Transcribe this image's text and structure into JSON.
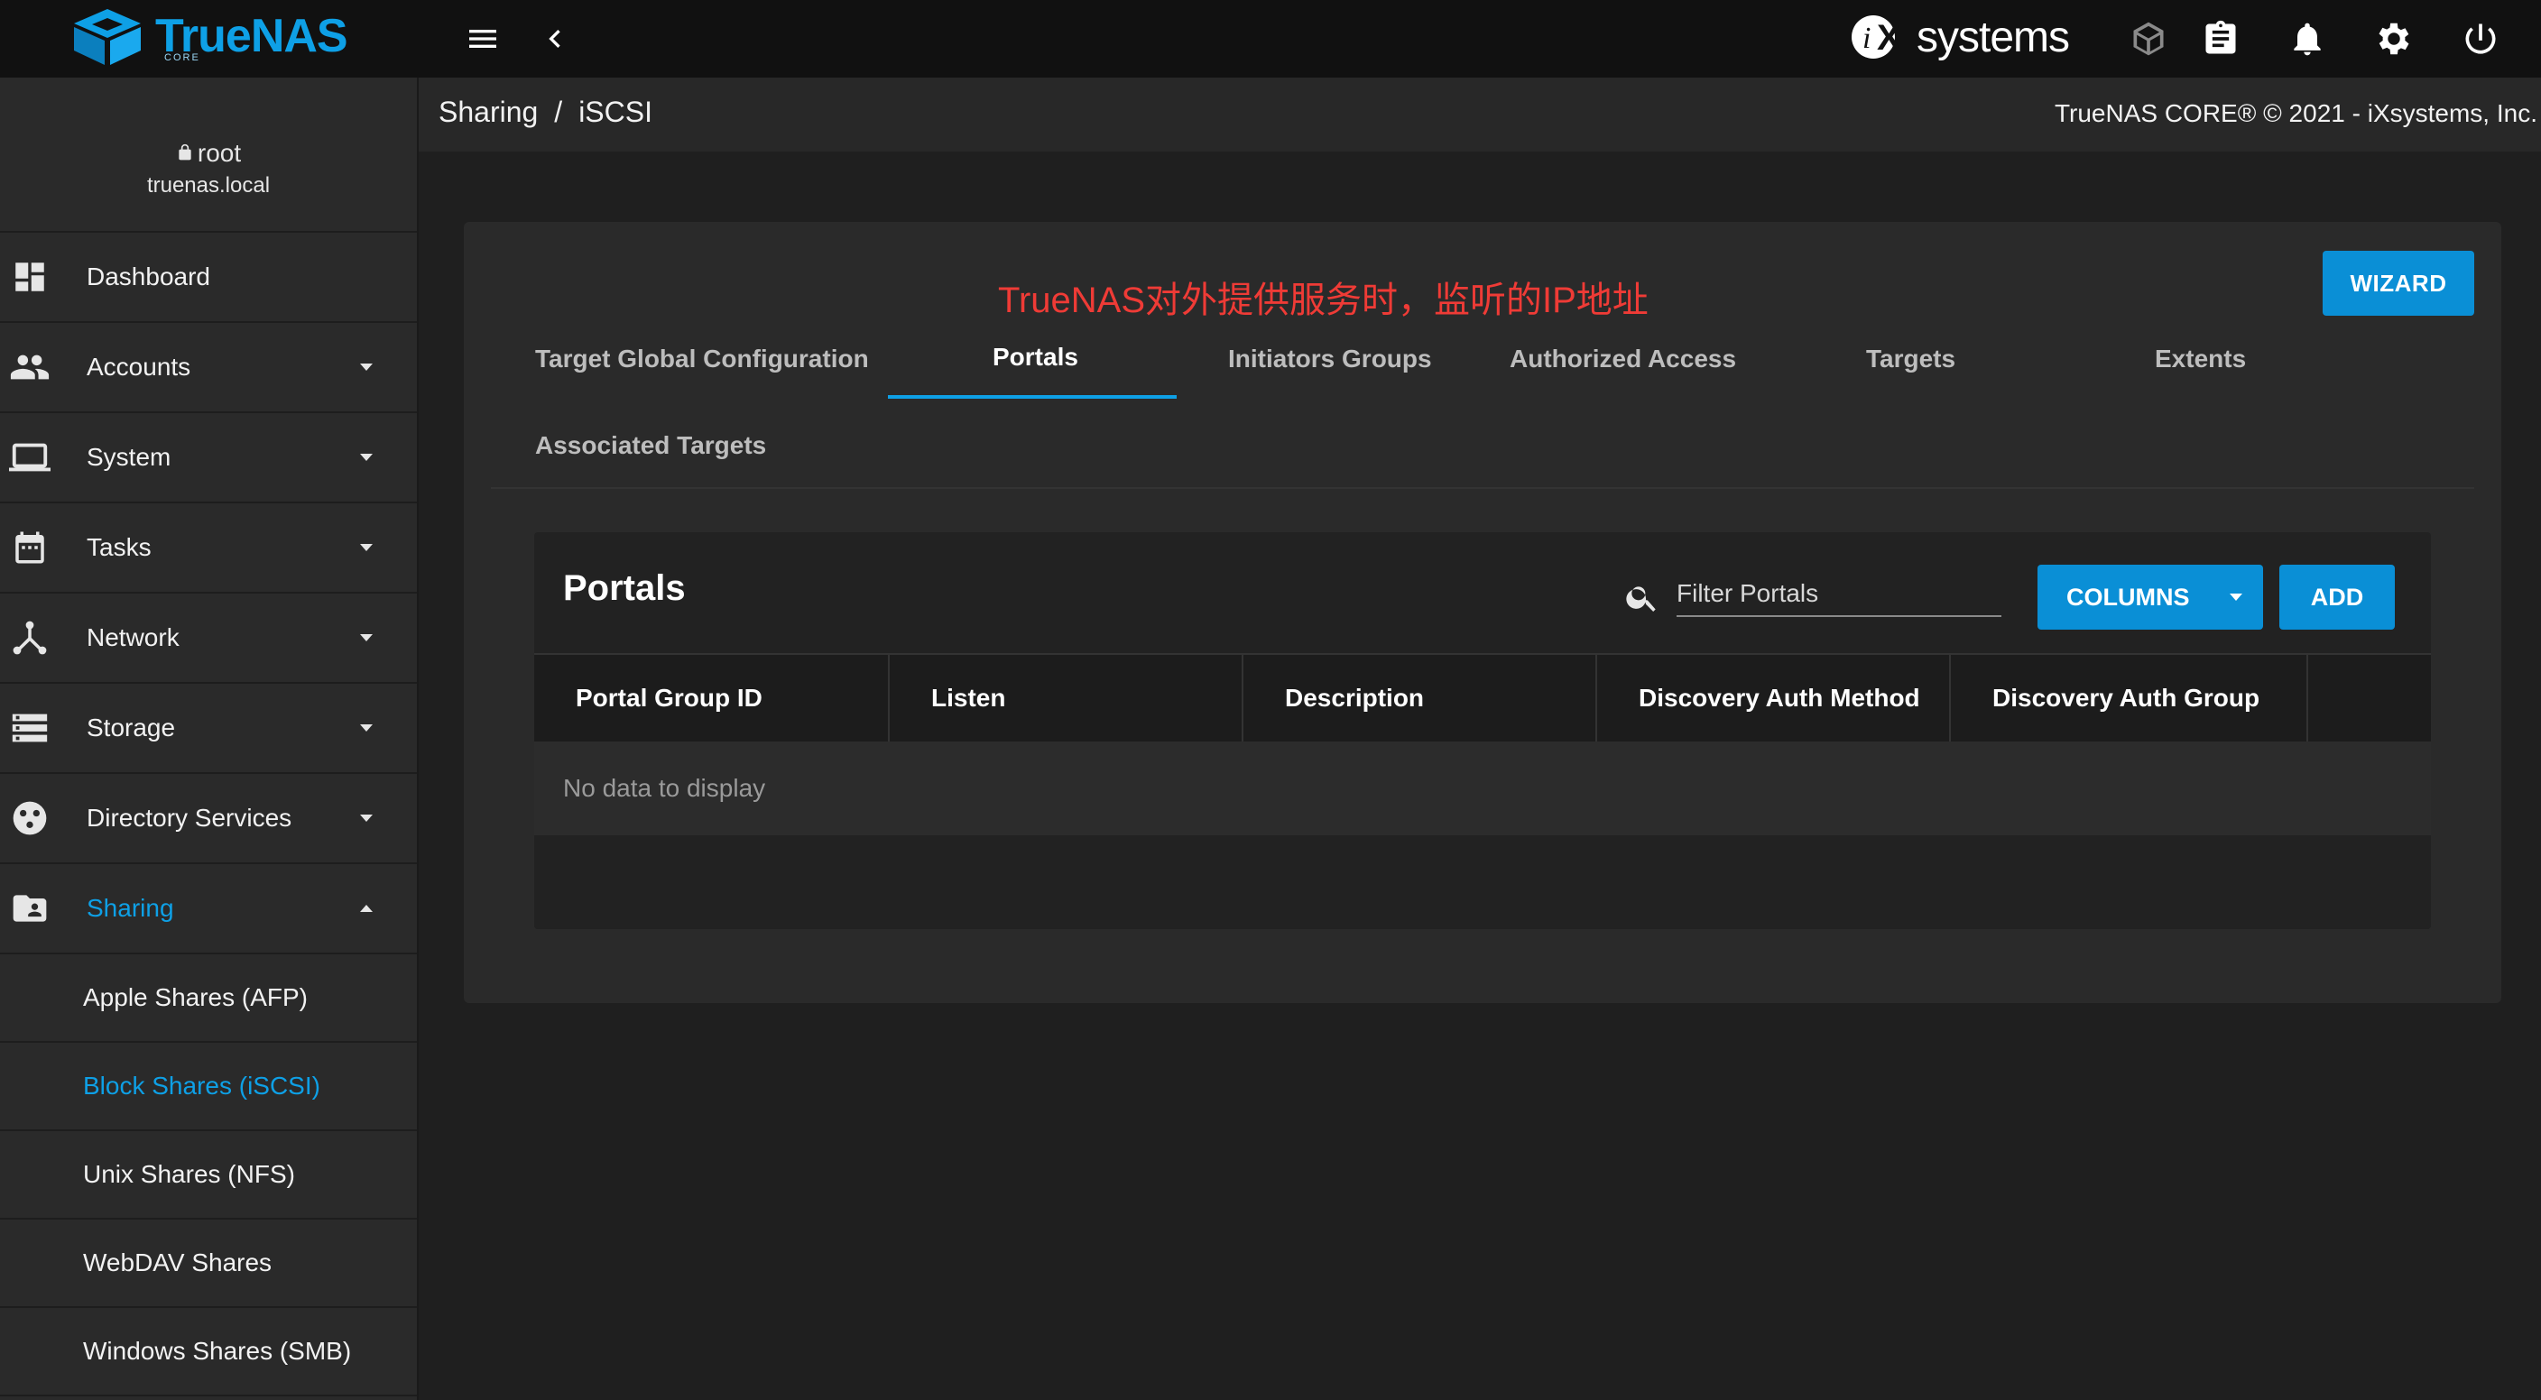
{
  "topbar": {
    "logo_text": "TrueNAS",
    "logo_sub": "CORE",
    "vendor_logo": "iXsystems",
    "vendor_logo_text": "systems",
    "icons": [
      "menu-icon",
      "chevron-left-icon",
      "truecommand-icon",
      "clipboard-icon",
      "bell-icon",
      "gear-icon",
      "power-icon"
    ]
  },
  "user": {
    "name": "root",
    "host": "truenas.local"
  },
  "sidebar": {
    "items": [
      {
        "label": "Dashboard",
        "icon": "dashboard-icon",
        "expandable": false
      },
      {
        "label": "Accounts",
        "icon": "people-icon",
        "expandable": true
      },
      {
        "label": "System",
        "icon": "laptop-icon",
        "expandable": true
      },
      {
        "label": "Tasks",
        "icon": "calendar-icon",
        "expandable": true
      },
      {
        "label": "Network",
        "icon": "network-icon",
        "expandable": true
      },
      {
        "label": "Storage",
        "icon": "storage-icon",
        "expandable": true
      },
      {
        "label": "Directory Services",
        "icon": "directory-icon",
        "expandable": true
      },
      {
        "label": "Sharing",
        "icon": "folder-shared-icon",
        "expandable": true,
        "expanded": true,
        "active": true
      }
    ],
    "sub_items": [
      {
        "label": "Apple Shares (AFP)"
      },
      {
        "label": "Block Shares (iSCSI)",
        "active": true
      },
      {
        "label": "Unix Shares (NFS)"
      },
      {
        "label": "WebDAV Shares"
      },
      {
        "label": "Windows Shares (SMB)"
      }
    ]
  },
  "breadcrumb": {
    "parent": "Sharing",
    "separator": "/",
    "current": "iSCSI"
  },
  "copyright": "TrueNAS CORE® © 2021 - iXsystems, Inc.",
  "annotation": "TrueNAS对外提供服务时，监听的IP地址",
  "wizard_label": "WIZARD",
  "tabs": [
    {
      "label": "Target Global Configuration"
    },
    {
      "label": "Portals",
      "active": true
    },
    {
      "label": "Initiators Groups"
    },
    {
      "label": "Authorized Access"
    },
    {
      "label": "Targets"
    },
    {
      "label": "Extents"
    },
    {
      "label": "Associated Targets"
    }
  ],
  "table": {
    "title": "Portals",
    "filter_placeholder": "Filter Portals",
    "columns_label": "COLUMNS",
    "add_label": "ADD",
    "headers": [
      "Portal Group ID",
      "Listen",
      "Description",
      "Discovery Auth Method",
      "Discovery Auth Group"
    ],
    "empty_message": "No data to display"
  },
  "colors": {
    "accent": "#0ea0e6",
    "button": "#0a8fd6",
    "annotation": "#ef3b36"
  }
}
